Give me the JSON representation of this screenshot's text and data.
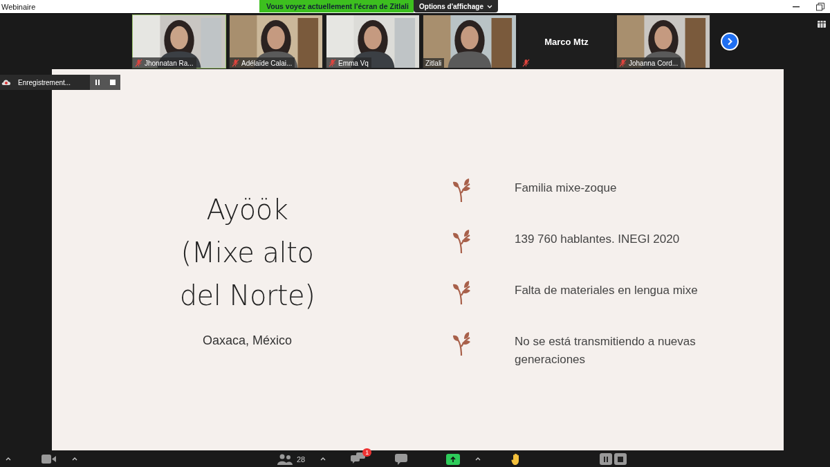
{
  "window": {
    "title": "Webinaire"
  },
  "share_banner": {
    "text": "Vous voyez actuellement l'écran de Zitlali",
    "options": "Options d'affichage"
  },
  "participants": [
    {
      "name": "Jhonnatan Ra...",
      "kind": "video",
      "muted": true,
      "selected": true
    },
    {
      "name": "Adélaïde Calai...",
      "kind": "video",
      "muted": true,
      "selected": false
    },
    {
      "name": "Emma Vq",
      "kind": "video",
      "muted": true,
      "selected": false
    },
    {
      "name": "Zitlali",
      "kind": "video",
      "muted": false,
      "selected": false
    },
    {
      "name": "Marco Mtz",
      "kind": "name",
      "muted": true,
      "selected": false
    },
    {
      "name": "Johanna Cord...",
      "kind": "video",
      "muted": true,
      "selected": false
    }
  ],
  "recording": {
    "label": "Enregistrement..."
  },
  "slide": {
    "title_lines": [
      "Ayöök",
      "(Mixe alto",
      "del Norte)"
    ],
    "subtitle": "Oaxaca, México",
    "bullets": [
      "Familia mixe-zoque",
      "139 760 hablantes. INEGI 2020",
      "Falta de materiales en lengua mixe",
      "No se está transmitiendo a nuevas generaciones"
    ]
  },
  "toolbar": {
    "participants_count": "28",
    "qa_badge": "1"
  }
}
